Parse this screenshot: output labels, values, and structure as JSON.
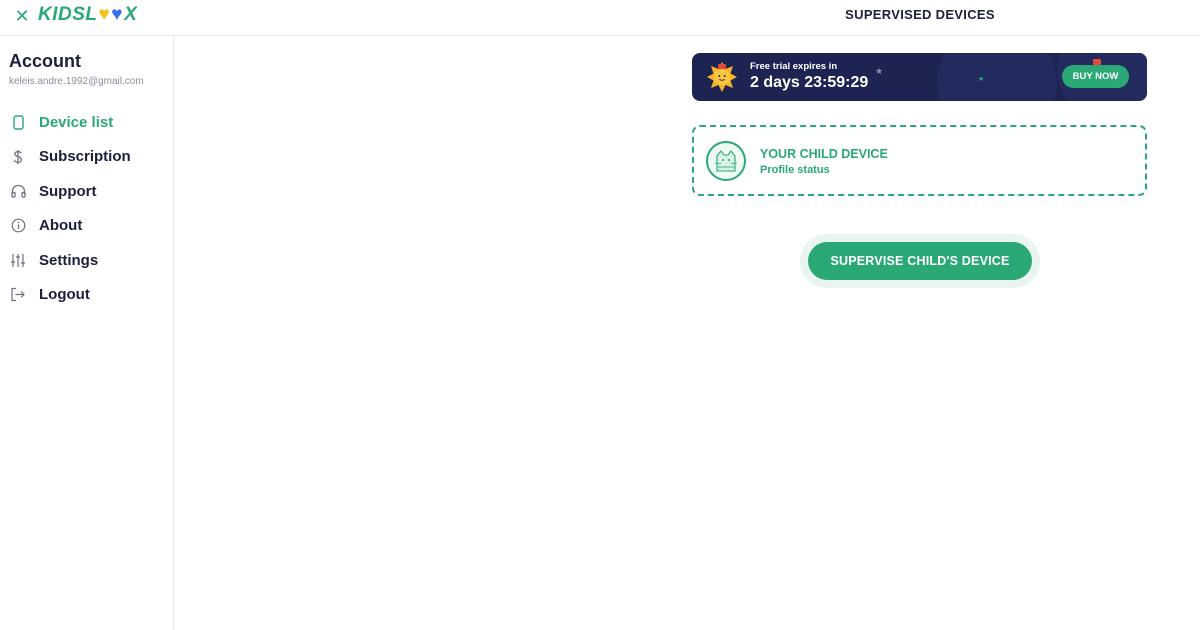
{
  "header": {
    "close_glyph": "✕",
    "logo": {
      "part1": "KIDSL",
      "heart1": "♥",
      "heart2": "♥",
      "part2": "X"
    },
    "title": "SUPERVISED DEVICES"
  },
  "sidebar": {
    "account_title": "Account",
    "email": "keleis.andre.1992@gmail.com",
    "items": [
      {
        "label": "Device list",
        "icon": "phone-icon",
        "active": true
      },
      {
        "label": "Subscription",
        "icon": "dollar-icon",
        "active": false
      },
      {
        "label": "Support",
        "icon": "headphones-icon",
        "active": false
      },
      {
        "label": "About",
        "icon": "info-icon",
        "active": false
      },
      {
        "label": "Settings",
        "icon": "sliders-icon",
        "active": false
      },
      {
        "label": "Logout",
        "icon": "logout-icon",
        "active": false
      }
    ]
  },
  "trial": {
    "label": "Free trial expires in",
    "countdown": "2 days 23:59:29",
    "buy_label": "BUY NOW"
  },
  "child_card": {
    "title": "YOUR CHILD DEVICE",
    "subtitle": "Profile status"
  },
  "supervise_label": "SUPERVISE CHILD'S DEVICE",
  "colors": {
    "accent": "#2aa876",
    "banner": "#1d2452",
    "text": "#1d1f3d"
  }
}
